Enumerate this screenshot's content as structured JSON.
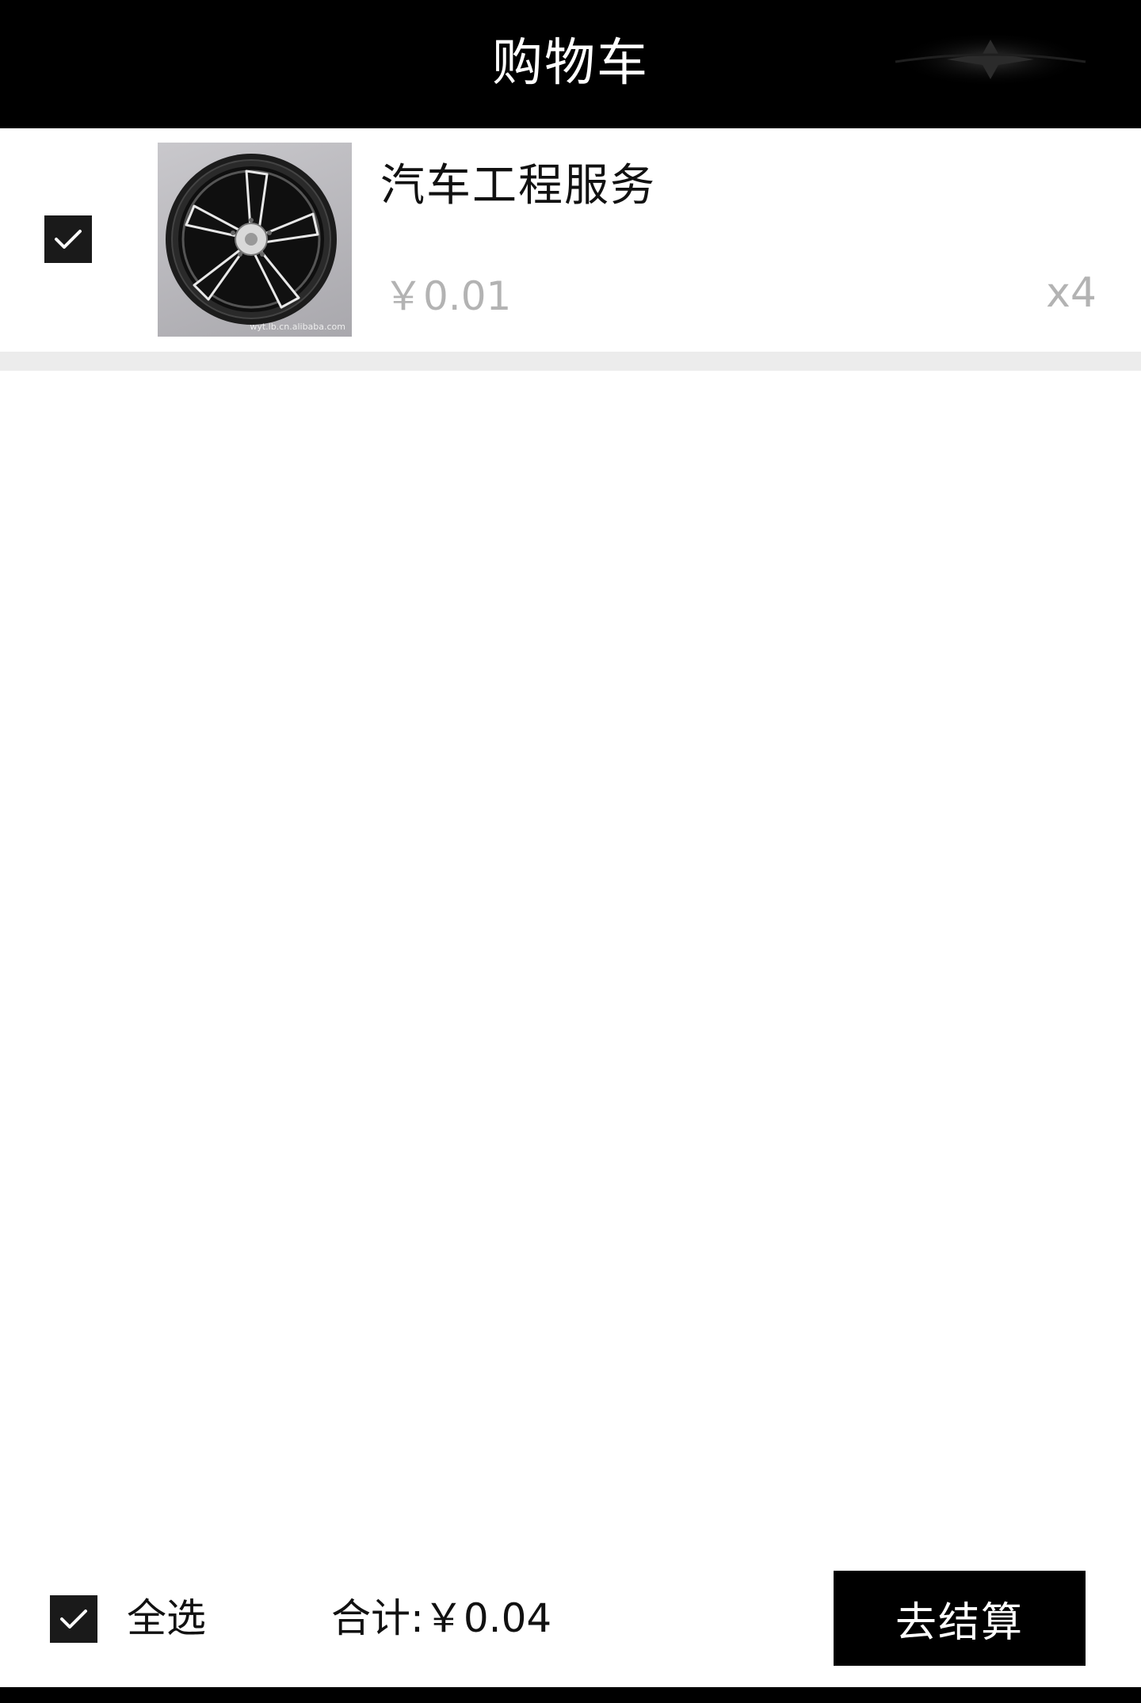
{
  "header": {
    "title": "购物车"
  },
  "cart": {
    "items": [
      {
        "name": "汽车工程服务",
        "price": "￥0.01",
        "quantity": "x4",
        "checked": true,
        "image": "alloy-wheel-rim",
        "image_watermark": "wyt.lb.cn.alibaba.com"
      }
    ]
  },
  "footer": {
    "select_all_label": "全选",
    "select_all_checked": true,
    "total_label": "合计:",
    "total_value": "￥0.04",
    "checkout_label": "去结算"
  },
  "colors": {
    "header_bg": "#000000",
    "header_text": "#ffffff",
    "checkbox_bg": "#1a1a1a",
    "price_text": "#b3b3b3",
    "divider": "#ececec",
    "checkout_bg": "#000000"
  },
  "icons": {
    "checkbox": "checkmark-icon",
    "header_decoration": "brand-logo-icon"
  }
}
